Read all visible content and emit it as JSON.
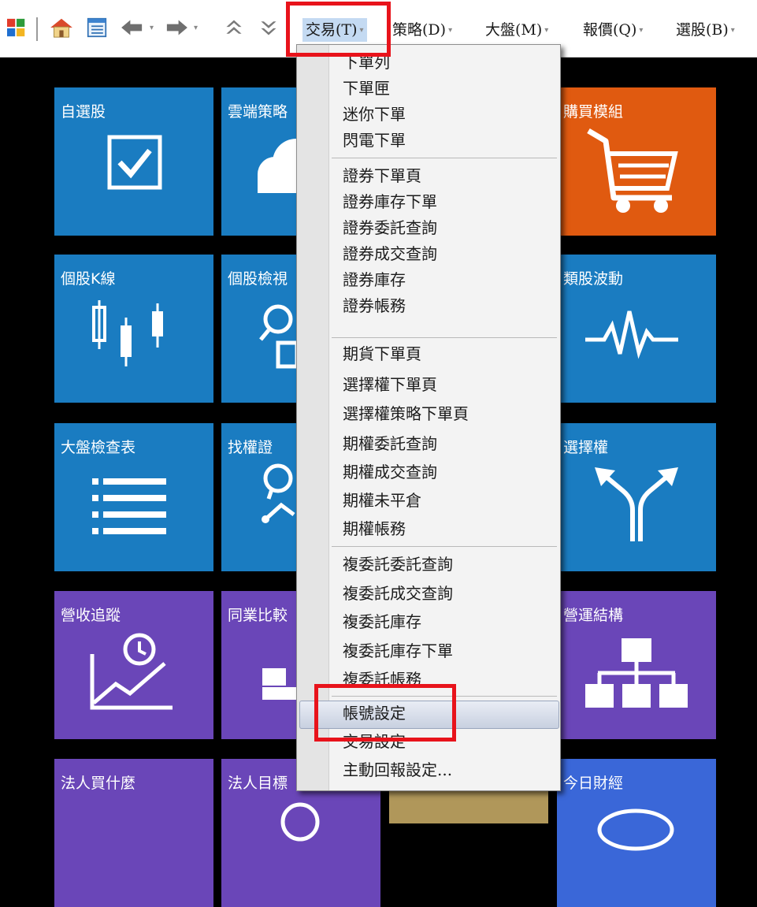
{
  "menubar": {
    "items": [
      {
        "label": "交易(T)"
      },
      {
        "label": "策略(D)"
      },
      {
        "label": "大盤(M)"
      },
      {
        "label": "報價(Q)"
      },
      {
        "label": "選股(B)"
      }
    ]
  },
  "tiles": [
    {
      "label": "自選股",
      "color": "#1a7cc1"
    },
    {
      "label": "雲端策略",
      "color": "#1a7cc1"
    },
    {
      "label": "購買模組",
      "color": "#e05a10"
    },
    {
      "label": "個股K線",
      "color": "#1a7cc1"
    },
    {
      "label": "個股檢視",
      "color": "#1a7cc1"
    },
    {
      "label": "類股波動",
      "color": "#1a7cc1"
    },
    {
      "label": "大盤檢查表",
      "color": "#1a7cc1"
    },
    {
      "label": "找權證",
      "color": "#1a7cc1"
    },
    {
      "label": "選擇權",
      "color": "#1a7cc1"
    },
    {
      "label": "營收追蹤",
      "color": "#6a46b8"
    },
    {
      "label": "同業比較",
      "color": "#6a46b8"
    },
    {
      "label": "營運結構",
      "color": "#6a46b8"
    },
    {
      "label": "法人買什麼",
      "color": "#6a46b8"
    },
    {
      "label": "法人目標",
      "color": "#6a46b8"
    },
    {
      "label": "今日財經",
      "color": "#3a67d8"
    }
  ],
  "dropdown": {
    "items": [
      "下單列",
      "下單匣",
      "迷你下單",
      "閃電下單",
      "證券下單頁",
      "證券庫存下單",
      "證券委託查詢",
      "證券成交查詢",
      "證券庫存",
      "證券帳務",
      "期貨下單頁",
      "選擇權下單頁",
      "選擇權策略下單頁",
      "期權委託查詢",
      "期權成交查詢",
      "期權未平倉",
      "期權帳務",
      "複委託委託查詢",
      "複委託成交查詢",
      "複委託庫存",
      "複委託庫存下單",
      "複委託帳務",
      "帳號設定",
      "交易設定",
      "主動回報設定..."
    ],
    "highlighted": "帳號設定"
  },
  "colors": {
    "highlight_box": "#e8131b",
    "menu_active_bg": "#c4daf2"
  }
}
